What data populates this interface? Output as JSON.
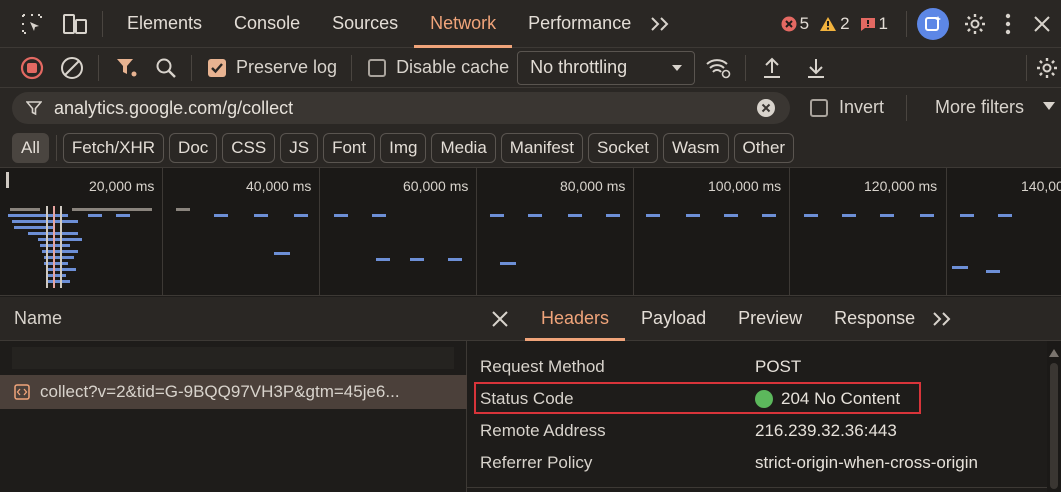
{
  "tabbar": {
    "tabs": [
      "Elements",
      "Console",
      "Sources",
      "Network",
      "Performance"
    ],
    "active": "Network",
    "errors": "5",
    "warnings": "2",
    "issues": "1"
  },
  "toolbar": {
    "preserve_log": "Preserve log",
    "disable_cache": "Disable cache",
    "throttling": "No throttling"
  },
  "filter": {
    "value": "analytics.google.com/g/collect",
    "invert": "Invert",
    "more_filters": "More filters"
  },
  "chips": [
    "All",
    "Fetch/XHR",
    "Doc",
    "CSS",
    "JS",
    "Font",
    "Img",
    "Media",
    "Manifest",
    "Socket",
    "Wasm",
    "Other"
  ],
  "timeline": {
    "ticks": [
      "20,000 ms",
      "40,000 ms",
      "60,000 ms",
      "80,000 ms",
      "100,000 ms",
      "120,000 ms",
      "140,00"
    ]
  },
  "requests": {
    "column": "Name",
    "selected": "collect?v=2&tid=G-9BQQ97VH3P&gtm=45je6..."
  },
  "details": {
    "tabs": [
      "Headers",
      "Payload",
      "Preview",
      "Response"
    ],
    "active": "Headers",
    "rows": [
      {
        "key": "Request Method",
        "value": "POST"
      },
      {
        "key": "Status Code",
        "value": "204 No Content"
      },
      {
        "key": "Remote Address",
        "value": "216.239.32.36:443"
      },
      {
        "key": "Referrer Policy",
        "value": "strict-origin-when-cross-origin"
      }
    ]
  },
  "colors": {
    "accent": "#f0a47a",
    "status_ok": "#5cb85c",
    "highlight": "#d8343a",
    "bar": "#6d8fd6"
  }
}
